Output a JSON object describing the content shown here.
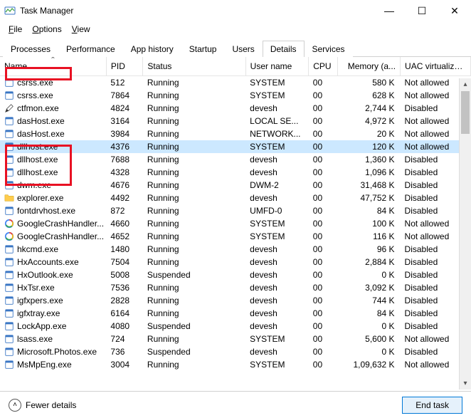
{
  "window": {
    "title": "Task Manager",
    "buttons": {
      "min": "—",
      "max": "☐",
      "close": "✕"
    }
  },
  "menu": {
    "file": "File",
    "options": "Options",
    "view": "View"
  },
  "tabs": [
    {
      "label": "Processes"
    },
    {
      "label": "Performance"
    },
    {
      "label": "App history"
    },
    {
      "label": "Startup"
    },
    {
      "label": "Users"
    },
    {
      "label": "Details",
      "active": true
    },
    {
      "label": "Services"
    }
  ],
  "columns": {
    "name": "Name",
    "pid": "PID",
    "status": "Status",
    "user": "User name",
    "cpu": "CPU",
    "mem": "Memory (a...",
    "uac": "UAC virtualizat..."
  },
  "processes": [
    {
      "icon": "generic",
      "name": "csrss.exe",
      "pid": "512",
      "status": "Running",
      "user": "SYSTEM",
      "cpu": "00",
      "mem": "580 K",
      "uac": "Not allowed"
    },
    {
      "icon": "generic",
      "name": "csrss.exe",
      "pid": "7864",
      "status": "Running",
      "user": "SYSTEM",
      "cpu": "00",
      "mem": "628 K",
      "uac": "Not allowed"
    },
    {
      "icon": "pen",
      "name": "ctfmon.exe",
      "pid": "4824",
      "status": "Running",
      "user": "devesh",
      "cpu": "00",
      "mem": "2,744 K",
      "uac": "Disabled"
    },
    {
      "icon": "generic",
      "name": "dasHost.exe",
      "pid": "3164",
      "status": "Running",
      "user": "LOCAL SE...",
      "cpu": "00",
      "mem": "4,972 K",
      "uac": "Not allowed"
    },
    {
      "icon": "generic",
      "name": "dasHost.exe",
      "pid": "3984",
      "status": "Running",
      "user": "NETWORK...",
      "cpu": "00",
      "mem": "20 K",
      "uac": "Not allowed"
    },
    {
      "icon": "generic",
      "name": "dllhost.exe",
      "pid": "4376",
      "status": "Running",
      "user": "SYSTEM",
      "cpu": "00",
      "mem": "120 K",
      "uac": "Not allowed",
      "selected": true
    },
    {
      "icon": "generic",
      "name": "dllhost.exe",
      "pid": "7688",
      "status": "Running",
      "user": "devesh",
      "cpu": "00",
      "mem": "1,360 K",
      "uac": "Disabled"
    },
    {
      "icon": "generic",
      "name": "dllhost.exe",
      "pid": "4328",
      "status": "Running",
      "user": "devesh",
      "cpu": "00",
      "mem": "1,096 K",
      "uac": "Disabled"
    },
    {
      "icon": "generic",
      "name": "dwm.exe",
      "pid": "4676",
      "status": "Running",
      "user": "DWM-2",
      "cpu": "00",
      "mem": "31,468 K",
      "uac": "Disabled"
    },
    {
      "icon": "folder",
      "name": "explorer.exe",
      "pid": "4492",
      "status": "Running",
      "user": "devesh",
      "cpu": "00",
      "mem": "47,752 K",
      "uac": "Disabled"
    },
    {
      "icon": "generic",
      "name": "fontdrvhost.exe",
      "pid": "872",
      "status": "Running",
      "user": "UMFD-0",
      "cpu": "00",
      "mem": "84 K",
      "uac": "Disabled"
    },
    {
      "icon": "google",
      "name": "GoogleCrashHandler...",
      "pid": "4660",
      "status": "Running",
      "user": "SYSTEM",
      "cpu": "00",
      "mem": "100 K",
      "uac": "Not allowed"
    },
    {
      "icon": "google",
      "name": "GoogleCrashHandler...",
      "pid": "4652",
      "status": "Running",
      "user": "SYSTEM",
      "cpu": "00",
      "mem": "116 K",
      "uac": "Not allowed"
    },
    {
      "icon": "generic",
      "name": "hkcmd.exe",
      "pid": "1480",
      "status": "Running",
      "user": "devesh",
      "cpu": "00",
      "mem": "96 K",
      "uac": "Disabled"
    },
    {
      "icon": "generic",
      "name": "HxAccounts.exe",
      "pid": "7504",
      "status": "Running",
      "user": "devesh",
      "cpu": "00",
      "mem": "2,884 K",
      "uac": "Disabled"
    },
    {
      "icon": "generic",
      "name": "HxOutlook.exe",
      "pid": "5008",
      "status": "Suspended",
      "user": "devesh",
      "cpu": "00",
      "mem": "0 K",
      "uac": "Disabled"
    },
    {
      "icon": "generic",
      "name": "HxTsr.exe",
      "pid": "7536",
      "status": "Running",
      "user": "devesh",
      "cpu": "00",
      "mem": "3,092 K",
      "uac": "Disabled"
    },
    {
      "icon": "generic",
      "name": "igfxpers.exe",
      "pid": "2828",
      "status": "Running",
      "user": "devesh",
      "cpu": "00",
      "mem": "744 K",
      "uac": "Disabled"
    },
    {
      "icon": "generic",
      "name": "igfxtray.exe",
      "pid": "6164",
      "status": "Running",
      "user": "devesh",
      "cpu": "00",
      "mem": "84 K",
      "uac": "Disabled"
    },
    {
      "icon": "generic",
      "name": "LockApp.exe",
      "pid": "4080",
      "status": "Suspended",
      "user": "devesh",
      "cpu": "00",
      "mem": "0 K",
      "uac": "Disabled"
    },
    {
      "icon": "generic",
      "name": "lsass.exe",
      "pid": "724",
      "status": "Running",
      "user": "SYSTEM",
      "cpu": "00",
      "mem": "5,600 K",
      "uac": "Not allowed"
    },
    {
      "icon": "generic",
      "name": "Microsoft.Photos.exe",
      "pid": "736",
      "status": "Suspended",
      "user": "devesh",
      "cpu": "00",
      "mem": "0 K",
      "uac": "Disabled"
    },
    {
      "icon": "generic",
      "name": "MsMpEng.exe",
      "pid": "3004",
      "status": "Running",
      "user": "SYSTEM",
      "cpu": "00",
      "mem": "1,09,632 K",
      "uac": "Not allowed"
    }
  ],
  "footer": {
    "fewer": "Fewer details",
    "endtask": "End task"
  }
}
